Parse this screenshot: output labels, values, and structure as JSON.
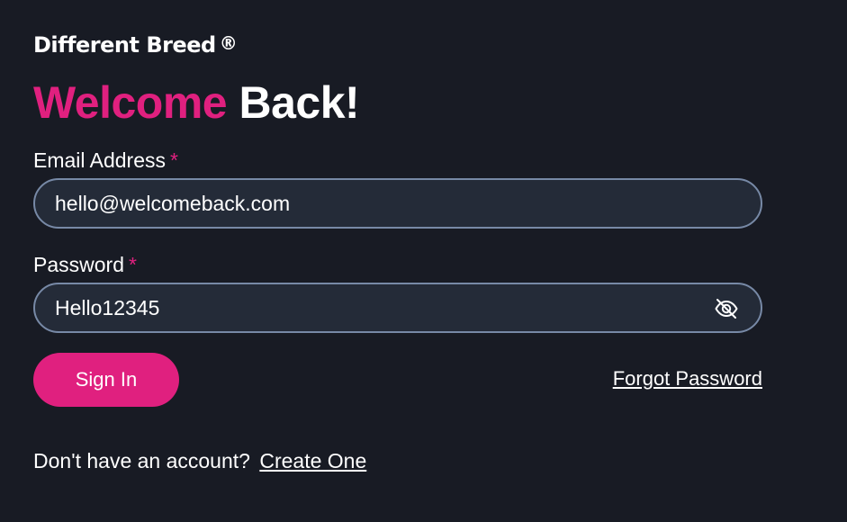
{
  "brand": {
    "name": "Different Breed",
    "registered_mark": "®"
  },
  "heading": {
    "accent_word": "Welcome",
    "rest": "Back!",
    "accent_color": "#e0207f"
  },
  "form": {
    "email": {
      "label": "Email Address",
      "required_mark": "*",
      "value": "hello@welcomeback.com"
    },
    "password": {
      "label": "Password",
      "required_mark": "*",
      "value": "Hello12345",
      "visibility_icon": "eye-off-icon"
    },
    "sign_in_label": "Sign In",
    "forgot_password_label": "Forgot Password"
  },
  "signup": {
    "prompt": "Don't have an account?",
    "link_label": "Create One"
  },
  "colors": {
    "background": "#181b24",
    "input_background": "#242b38",
    "input_border": "#7789a6",
    "accent": "#e0207f"
  }
}
